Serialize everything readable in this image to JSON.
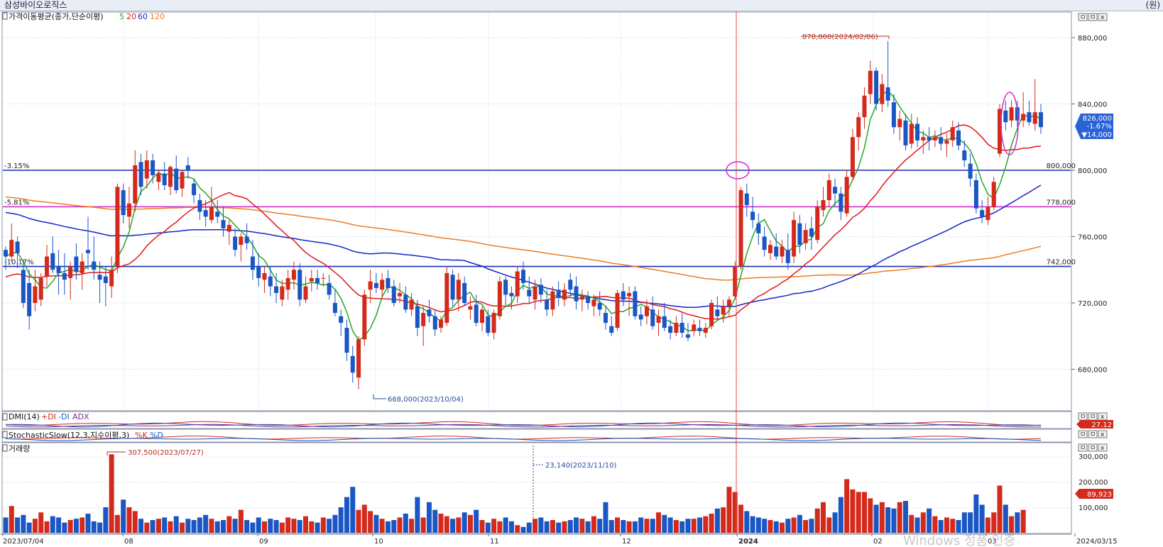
{
  "window": {
    "title": "삼성바이오로직스",
    "unit_label": "(원)"
  },
  "legend": {
    "price": {
      "prefix": "가격이동평균(종가,단순이평)",
      "periods": [
        "5",
        "20",
        "60",
        "120"
      ]
    },
    "dmi": {
      "name": "DMI(14)",
      "items": [
        "+DI",
        "-DI",
        "ADX"
      ]
    },
    "stoch": {
      "name": "StochasticSlow(12,3,지수이평,3)",
      "items": [
        "%K",
        "%D"
      ]
    },
    "volume": {
      "name": "거래량"
    }
  },
  "colors": {
    "up": "#d42a1c",
    "down": "#1a56c4",
    "ma5": "#2aa52a",
    "ma20": "#e01818",
    "ma60": "#1624c8",
    "ma120": "#f07b22",
    "hline_blue": "#1a2fb8",
    "hline_magenta": "#d22bd2",
    "vline": "#e04848",
    "annotation_red": "#b03020",
    "annotation_blue": "#2a4a9a",
    "circle": "#d22bd2",
    "grid": "#c9d3e4"
  },
  "chart_data": {
    "type": "candlestick",
    "price_axis": {
      "ylim": [
        650000,
        890000
      ],
      "ticks": [
        "880,000",
        "840,000",
        "800,000",
        "760,000",
        "720,000",
        "680,000"
      ]
    },
    "x_axis": {
      "labels": [
        "2023/07/04",
        "08",
        "09",
        "10",
        "11",
        "12",
        "2024",
        "02",
        "03",
        "2024/03/15"
      ]
    },
    "horizontal_lines": [
      {
        "price": 800000,
        "label": "800,000",
        "pct_label": "-3.15%",
        "color": "blue"
      },
      {
        "price": 778000,
        "label": "778,000",
        "pct_label": "-5.81%",
        "color": "magenta"
      },
      {
        "price": 742000,
        "label": "742,000",
        "pct_label": "-10.17%",
        "color": "blue"
      }
    ],
    "annotations": {
      "high": "878,000(2024/02/06)",
      "low": "668,000(2023/10/04)",
      "vol_high": "307,500(2023/07/27)",
      "vol_low": "23,140(2023/11/10)"
    },
    "current": {
      "price": "826,000",
      "change_pct": "-1.67%",
      "change": "▼14,000"
    },
    "dmi_value": "27.12",
    "volume_axis": {
      "ticks": [
        "300,000",
        "200,000",
        "100,000"
      ],
      "current": "89,923"
    },
    "candles": [
      [
        752000,
        754000,
        740000,
        748000
      ],
      [
        748000,
        768000,
        745000,
        758000
      ],
      [
        757000,
        760000,
        741000,
        750000
      ],
      [
        740000,
        746000,
        717000,
        720000
      ],
      [
        732000,
        740000,
        704000,
        712000
      ],
      [
        720000,
        740000,
        715000,
        730000
      ],
      [
        722000,
        738000,
        718000,
        735000
      ],
      [
        736000,
        755000,
        730000,
        748000
      ],
      [
        750000,
        760000,
        738000,
        740000
      ],
      [
        742000,
        752000,
        725000,
        738000
      ],
      [
        738000,
        750000,
        725000,
        734000
      ],
      [
        735000,
        745000,
        722000,
        742000
      ],
      [
        748000,
        756000,
        734000,
        739000
      ],
      [
        738000,
        750000,
        728000,
        745000
      ],
      [
        752000,
        772000,
        740000,
        750000
      ],
      [
        745000,
        760000,
        734000,
        740000
      ],
      [
        737000,
        745000,
        720000,
        734000
      ],
      [
        736000,
        742000,
        718000,
        732000
      ],
      [
        730000,
        748000,
        723000,
        740000
      ],
      [
        742000,
        792000,
        738000,
        790000
      ],
      [
        788000,
        792000,
        768000,
        773000
      ],
      [
        772000,
        790000,
        765000,
        780000
      ],
      [
        780000,
        812000,
        775000,
        803000
      ],
      [
        805000,
        810000,
        785000,
        790000
      ],
      [
        795000,
        812000,
        789000,
        806000
      ],
      [
        806000,
        810000,
        792000,
        797000
      ],
      [
        793000,
        800000,
        788000,
        798000
      ],
      [
        798000,
        805000,
        788000,
        791000
      ],
      [
        790000,
        803000,
        785000,
        802000
      ],
      [
        801000,
        809000,
        786000,
        788000
      ],
      [
        789000,
        800000,
        784000,
        799000
      ],
      [
        803000,
        808000,
        795000,
        800000
      ],
      [
        792000,
        795000,
        780000,
        785000
      ],
      [
        782000,
        786000,
        770000,
        775000
      ],
      [
        776000,
        782000,
        766000,
        772000
      ],
      [
        770000,
        790000,
        768000,
        778000
      ],
      [
        775000,
        782000,
        768000,
        772000
      ],
      [
        770000,
        778000,
        760000,
        765000
      ],
      [
        763000,
        770000,
        755000,
        767000
      ],
      [
        760000,
        765000,
        748000,
        752000
      ],
      [
        755000,
        762000,
        745000,
        760000
      ],
      [
        760000,
        768000,
        752000,
        756000
      ],
      [
        748000,
        758000,
        734000,
        740000
      ],
      [
        742000,
        750000,
        730000,
        735000
      ],
      [
        734000,
        742000,
        726000,
        738000
      ],
      [
        736000,
        742000,
        724000,
        730000
      ],
      [
        730000,
        738000,
        720000,
        726000
      ],
      [
        722000,
        734000,
        718000,
        730000
      ],
      [
        728000,
        740000,
        722000,
        735000
      ],
      [
        734000,
        745000,
        728000,
        740000
      ],
      [
        740000,
        744000,
        718000,
        722000
      ],
      [
        722000,
        736000,
        720000,
        730000
      ],
      [
        733000,
        740000,
        727000,
        735000
      ],
      [
        735000,
        740000,
        728000,
        732000
      ],
      [
        735000,
        738000,
        730000,
        735000
      ],
      [
        732000,
        737000,
        722000,
        725000
      ],
      [
        720000,
        728000,
        712000,
        714000
      ],
      [
        712000,
        716000,
        700000,
        708000
      ],
      [
        705000,
        710000,
        685000,
        690000
      ],
      [
        688000,
        694000,
        672000,
        678000
      ],
      [
        675000,
        700000,
        668000,
        698000
      ],
      [
        698000,
        728000,
        694000,
        725000
      ],
      [
        728000,
        740000,
        720000,
        733000
      ],
      [
        732000,
        738000,
        726000,
        729000
      ],
      [
        728000,
        738000,
        723000,
        734000
      ],
      [
        735000,
        740000,
        726000,
        729000
      ],
      [
        730000,
        734000,
        718000,
        720000
      ],
      [
        724000,
        732000,
        720000,
        726000
      ],
      [
        725000,
        730000,
        714000,
        716000
      ],
      [
        716000,
        726000,
        712000,
        722000
      ],
      [
        718000,
        722000,
        700000,
        705000
      ],
      [
        706000,
        718000,
        694000,
        714000
      ],
      [
        716000,
        722000,
        708000,
        712000
      ],
      [
        712000,
        716000,
        700000,
        704000
      ],
      [
        705000,
        712000,
        702000,
        710000
      ],
      [
        708000,
        742000,
        706000,
        738000
      ],
      [
        737000,
        740000,
        718000,
        722000
      ],
      [
        722000,
        738000,
        715000,
        734000
      ],
      [
        732000,
        736000,
        718000,
        720000
      ],
      [
        716000,
        724000,
        710000,
        718000
      ],
      [
        719000,
        725000,
        706000,
        708000
      ],
      [
        708000,
        718000,
        703000,
        716000
      ],
      [
        712000,
        716000,
        700000,
        702000
      ],
      [
        702000,
        716000,
        698000,
        714000
      ],
      [
        712000,
        736000,
        710000,
        733000
      ],
      [
        734000,
        736000,
        718000,
        725000
      ],
      [
        726000,
        730000,
        716000,
        724000
      ],
      [
        724000,
        742000,
        720000,
        739000
      ],
      [
        740000,
        745000,
        728000,
        732000
      ],
      [
        728000,
        736000,
        720000,
        724000
      ],
      [
        722000,
        734000,
        716000,
        730000
      ],
      [
        731000,
        735000,
        720000,
        725000
      ],
      [
        722000,
        728000,
        712000,
        716000
      ],
      [
        716000,
        730000,
        712000,
        727000
      ],
      [
        728000,
        733000,
        718000,
        723000
      ],
      [
        722000,
        732000,
        718000,
        728000
      ],
      [
        734000,
        738000,
        724000,
        728000
      ],
      [
        730000,
        736000,
        716000,
        721000
      ],
      [
        722000,
        728000,
        715000,
        724000
      ],
      [
        724000,
        727000,
        716000,
        720000
      ],
      [
        718000,
        725000,
        712000,
        722000
      ],
      [
        720000,
        727000,
        712000,
        716000
      ],
      [
        714000,
        718000,
        704000,
        708000
      ],
      [
        706000,
        712000,
        700000,
        702000
      ],
      [
        705000,
        728000,
        703000,
        726000
      ],
      [
        727000,
        732000,
        718000,
        722000
      ],
      [
        724000,
        730000,
        712000,
        726000
      ],
      [
        727000,
        730000,
        710000,
        712000
      ],
      [
        713000,
        718000,
        706000,
        710000
      ],
      [
        712000,
        722000,
        707000,
        718000
      ],
      [
        716000,
        724000,
        704000,
        706000
      ],
      [
        708000,
        716000,
        700000,
        712000
      ],
      [
        712000,
        720000,
        703000,
        705000
      ],
      [
        706000,
        710000,
        698000,
        702000
      ],
      [
        702000,
        712000,
        700000,
        708000
      ],
      [
        708000,
        714000,
        699000,
        702000
      ],
      [
        701000,
        708000,
        697000,
        699000
      ],
      [
        703000,
        710000,
        700000,
        707000
      ],
      [
        705000,
        710000,
        700000,
        703000
      ],
      [
        702000,
        708000,
        699000,
        705000
      ],
      [
        706000,
        722000,
        704000,
        720000
      ],
      [
        716000,
        724000,
        710000,
        712000
      ],
      [
        713000,
        722000,
        708000,
        718000
      ],
      [
        718000,
        724000,
        712000,
        722000
      ],
      [
        724000,
        745000,
        722000,
        742000
      ],
      [
        742000,
        790000,
        740000,
        788000
      ],
      [
        786000,
        792000,
        772000,
        779000
      ],
      [
        775000,
        784000,
        765000,
        770000
      ],
      [
        768000,
        774000,
        755000,
        762000
      ],
      [
        760000,
        766000,
        748000,
        752000
      ],
      [
        750000,
        758000,
        746000,
        755000
      ],
      [
        754000,
        762000,
        746000,
        748000
      ],
      [
        748000,
        758000,
        744000,
        754000
      ],
      [
        752000,
        762000,
        740000,
        744000
      ],
      [
        748000,
        775000,
        744000,
        770000
      ],
      [
        768000,
        773000,
        750000,
        755000
      ],
      [
        756000,
        768000,
        752000,
        764000
      ],
      [
        765000,
        772000,
        752000,
        760000
      ],
      [
        758000,
        782000,
        756000,
        778000
      ],
      [
        776000,
        790000,
        772000,
        782000
      ],
      [
        782000,
        798000,
        778000,
        794000
      ],
      [
        790000,
        795000,
        778000,
        786000
      ],
      [
        786000,
        790000,
        770000,
        775000
      ],
      [
        774000,
        800000,
        772000,
        796000
      ],
      [
        796000,
        825000,
        794000,
        820000
      ],
      [
        820000,
        835000,
        812000,
        832000
      ],
      [
        832000,
        850000,
        825000,
        845000
      ],
      [
        846000,
        866000,
        840000,
        860000
      ],
      [
        860000,
        862000,
        836000,
        840000
      ],
      [
        840000,
        858000,
        835000,
        852000
      ],
      [
        850000,
        878000,
        838000,
        842000
      ],
      [
        841000,
        846000,
        822000,
        826000
      ],
      [
        826000,
        836000,
        818000,
        831000
      ],
      [
        830000,
        834000,
        812000,
        815000
      ],
      [
        816000,
        834000,
        813000,
        828000
      ],
      [
        828000,
        832000,
        814000,
        818000
      ],
      [
        818000,
        824000,
        810000,
        820000
      ],
      [
        820000,
        826000,
        812000,
        818000
      ],
      [
        818000,
        824000,
        814000,
        820000
      ],
      [
        820000,
        826000,
        812000,
        816000
      ],
      [
        816000,
        822000,
        808000,
        818000
      ],
      [
        818000,
        830000,
        814000,
        826000
      ],
      [
        824000,
        829000,
        812000,
        815000
      ],
      [
        812000,
        818000,
        802000,
        806000
      ],
      [
        804000,
        810000,
        790000,
        795000
      ],
      [
        794000,
        798000,
        774000,
        777000
      ],
      [
        776000,
        782000,
        768000,
        772000
      ],
      [
        770000,
        784000,
        767000,
        778000
      ],
      [
        778000,
        796000,
        776000,
        793000
      ],
      [
        810000,
        840000,
        808000,
        837000
      ],
      [
        836000,
        842000,
        824000,
        829000
      ],
      [
        830000,
        842000,
        826000,
        838000
      ],
      [
        838000,
        842000,
        826000,
        830000
      ],
      [
        830000,
        847000,
        826000,
        834000
      ],
      [
        835000,
        842000,
        827000,
        829000
      ],
      [
        828000,
        855000,
        824000,
        835000
      ],
      [
        835000,
        840000,
        822000,
        826000
      ]
    ],
    "volume": [
      60,
      105,
      60,
      70,
      40,
      55,
      80,
      45,
      65,
      60,
      40,
      50,
      55,
      60,
      75,
      45,
      40,
      100,
      307.5,
      70,
      130,
      100,
      85,
      55,
      40,
      50,
      55,
      60,
      45,
      65,
      40,
      55,
      50,
      60,
      70,
      55,
      45,
      50,
      65,
      55,
      90,
      50,
      40,
      60,
      45,
      55,
      50,
      40,
      60,
      55,
      50,
      65,
      45,
      40,
      60,
      55,
      70,
      100,
      140,
      180,
      90,
      110,
      85,
      70,
      55,
      45,
      50,
      60,
      75,
      55,
      140,
      60,
      120,
      90,
      75,
      65,
      55,
      60,
      80,
      70,
      90,
      50,
      40,
      55,
      45,
      60,
      45,
      30,
      23.14,
      40,
      55,
      60,
      45,
      50,
      40,
      45,
      50,
      60,
      55,
      45,
      65,
      55,
      120,
      50,
      60,
      50,
      45,
      45,
      60,
      55,
      55,
      80,
      70,
      60,
      50,
      45,
      55,
      55,
      60,
      65,
      75,
      95,
      100,
      180,
      160,
      110,
      85,
      65,
      60,
      55,
      50,
      45,
      40,
      55,
      60,
      70,
      50,
      55,
      95,
      120,
      60,
      80,
      140,
      210,
      170,
      160,
      160,
      135,
      110,
      120,
      100,
      95,
      120,
      125,
      70,
      60,
      80,
      95,
      65,
      50,
      60,
      55,
      50,
      80,
      80,
      150,
      110,
      60,
      80,
      185,
      110,
      65,
      80,
      89.923
    ]
  }
}
